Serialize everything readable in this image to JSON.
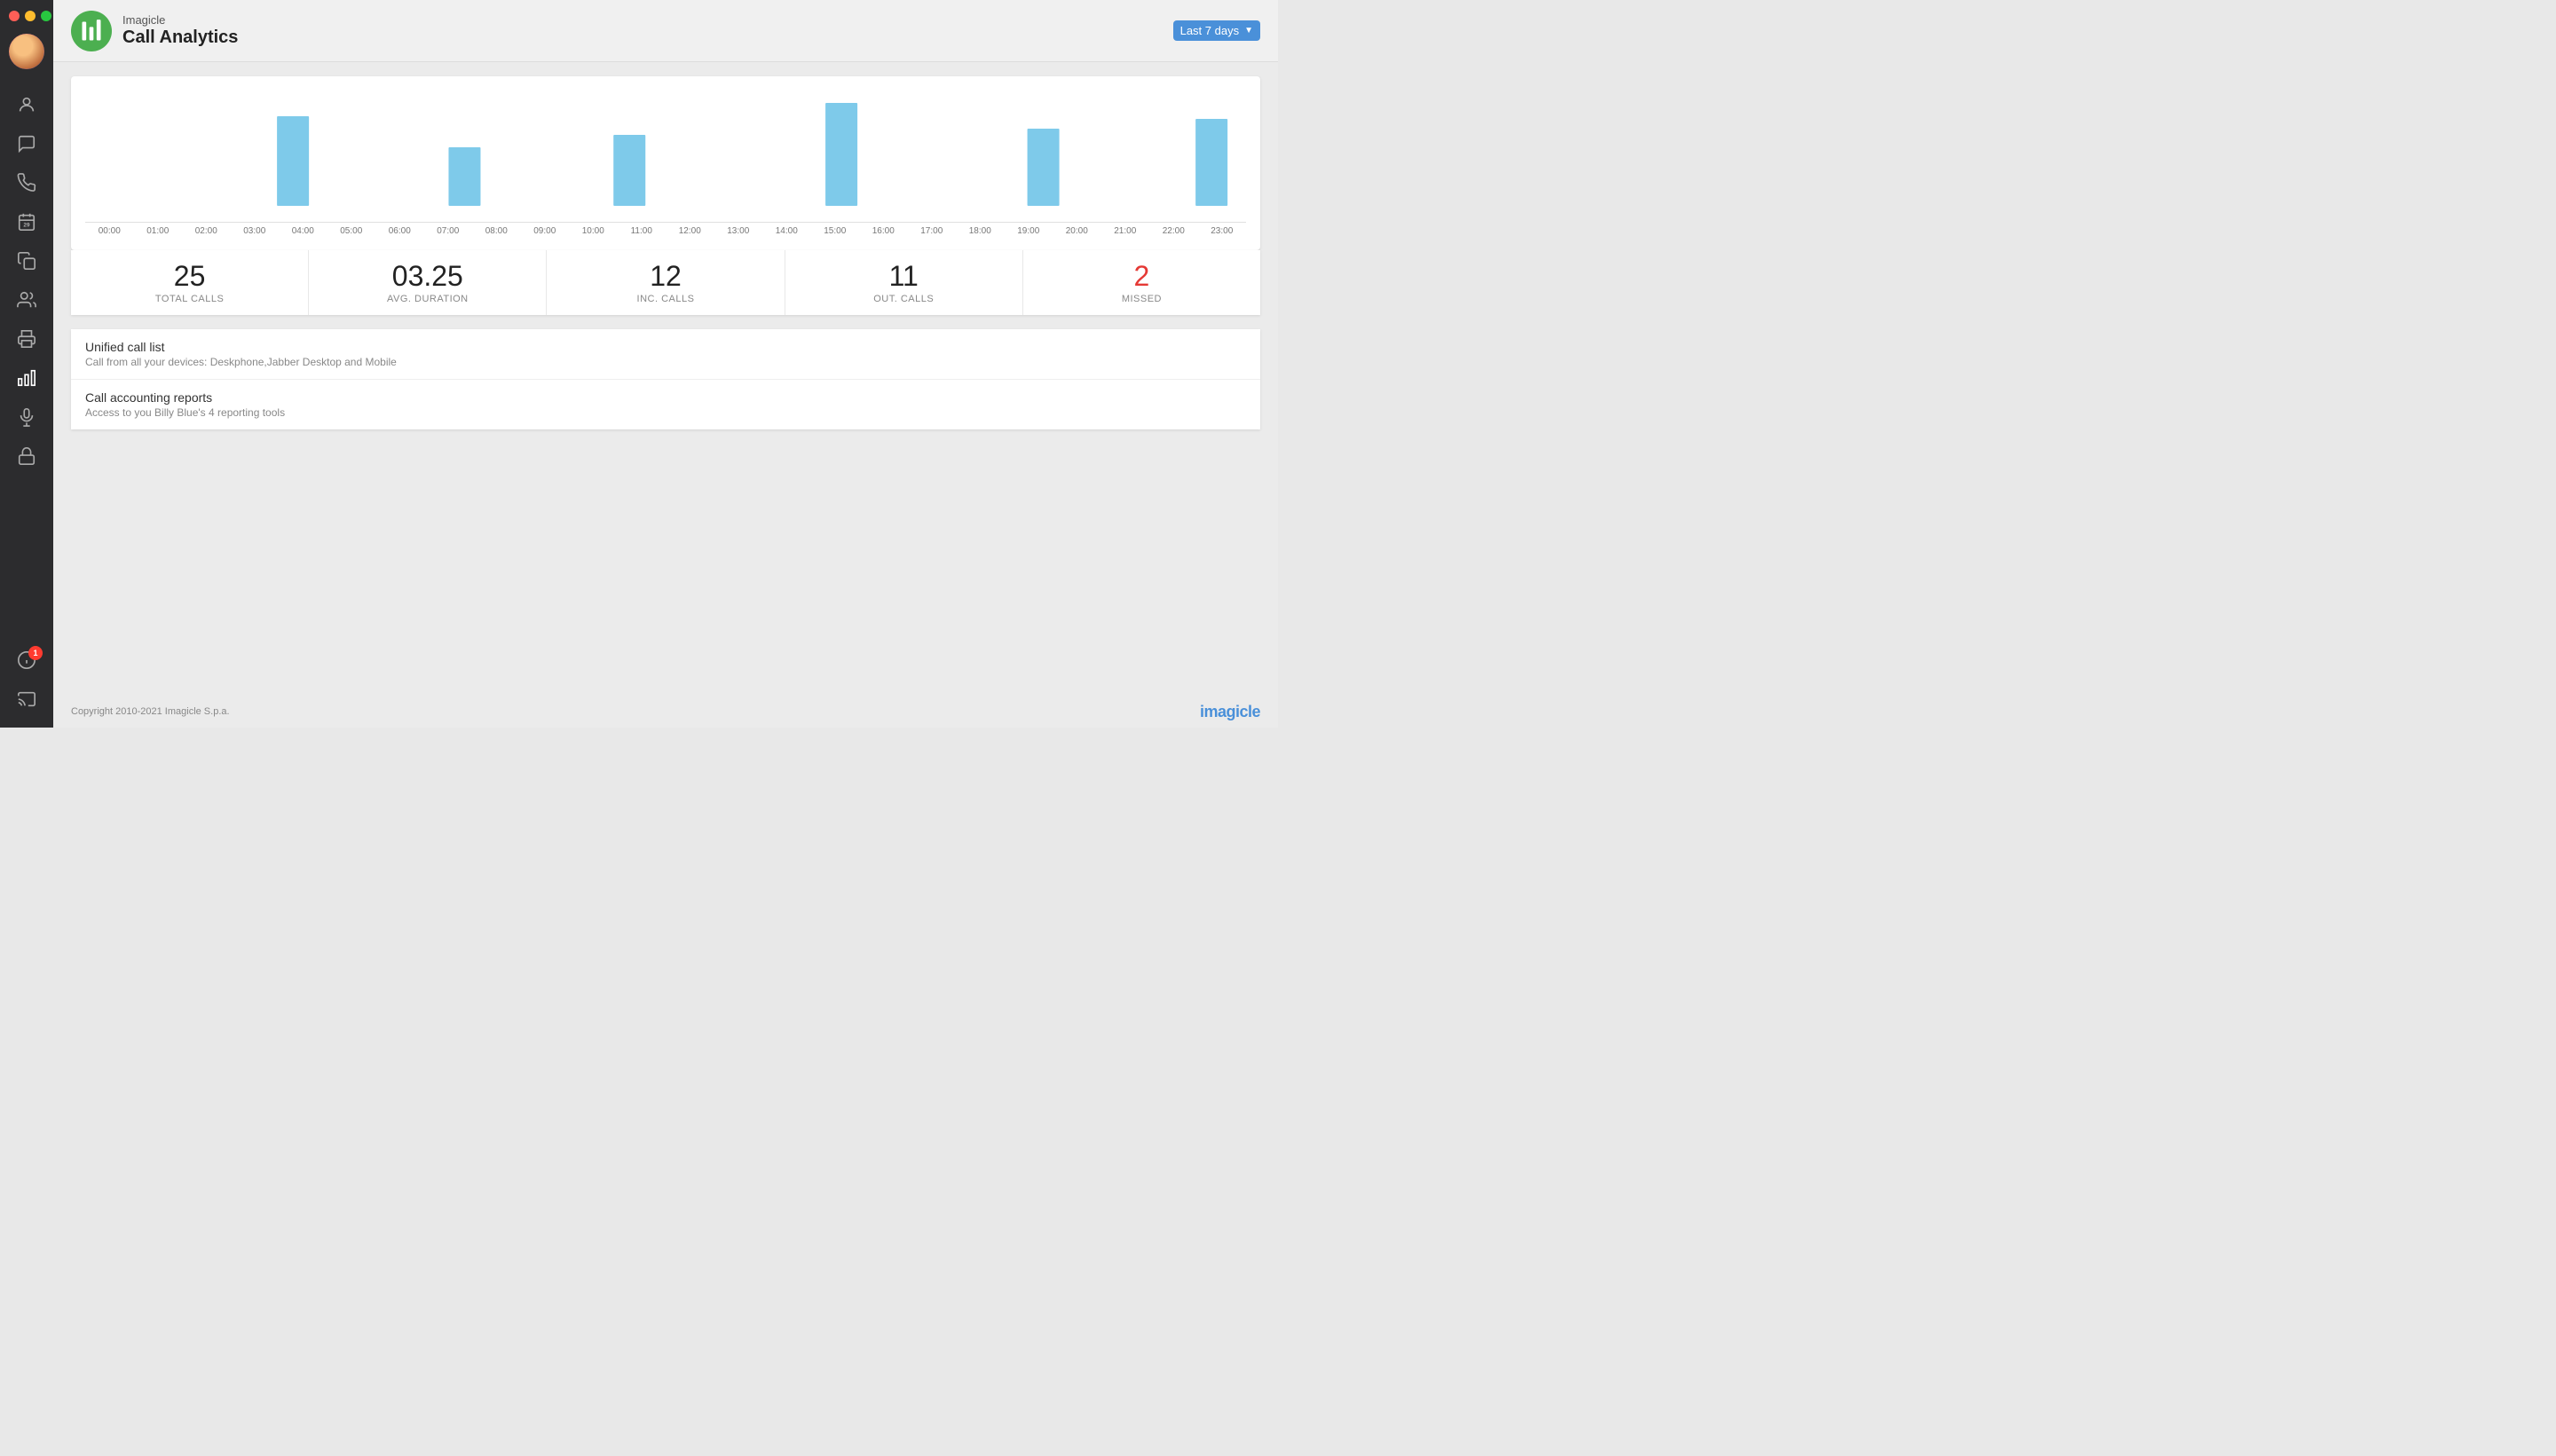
{
  "sidebar": {
    "nav_items": [
      {
        "id": "user",
        "icon": "user-icon",
        "active": false
      },
      {
        "id": "chat",
        "icon": "chat-icon",
        "active": false
      },
      {
        "id": "phone",
        "icon": "phone-icon",
        "active": false
      },
      {
        "id": "calendar",
        "icon": "calendar-icon",
        "active": false
      },
      {
        "id": "copy",
        "icon": "copy-icon",
        "active": false
      },
      {
        "id": "contacts",
        "icon": "contacts-icon",
        "active": false
      },
      {
        "id": "print",
        "icon": "print-icon",
        "active": false
      },
      {
        "id": "analytics",
        "icon": "analytics-icon",
        "active": true
      },
      {
        "id": "mic",
        "icon": "mic-icon",
        "active": false
      },
      {
        "id": "lock",
        "icon": "lock-icon",
        "active": false
      }
    ],
    "bottom_items": [
      {
        "id": "info",
        "icon": "info-icon",
        "badge": "1"
      },
      {
        "id": "cast",
        "icon": "cast-icon"
      }
    ]
  },
  "header": {
    "app_name_top": "Imagicle",
    "app_name_main": "Call Analytics",
    "date_filter": "Last 7 days"
  },
  "chart": {
    "bars": [
      {
        "hour": "00:00",
        "value": 0
      },
      {
        "hour": "01:00",
        "value": 0
      },
      {
        "hour": "02:00",
        "value": 0
      },
      {
        "hour": "03:00",
        "value": 0
      },
      {
        "hour": "04:00",
        "value": 75
      },
      {
        "hour": "05:00",
        "value": 0
      },
      {
        "hour": "06:00",
        "value": 0
      },
      {
        "hour": "07:00",
        "value": 45
      },
      {
        "hour": "08:00",
        "value": 0
      },
      {
        "hour": "09:00",
        "value": 0
      },
      {
        "hour": "10:00",
        "value": 55
      },
      {
        "hour": "11:00",
        "value": 0
      },
      {
        "hour": "12:00",
        "value": 0
      },
      {
        "hour": "13:00",
        "value": 0
      },
      {
        "hour": "14:00",
        "value": 90
      },
      {
        "hour": "15:00",
        "value": 0
      },
      {
        "hour": "16:00",
        "value": 0
      },
      {
        "hour": "17:00",
        "value": 0
      },
      {
        "hour": "18:00",
        "value": 60
      },
      {
        "hour": "19:00",
        "value": 0
      },
      {
        "hour": "20:00",
        "value": 0
      },
      {
        "hour": "21:00",
        "value": 0
      },
      {
        "hour": "22:00",
        "value": 72
      },
      {
        "hour": "23:00",
        "value": 0
      }
    ]
  },
  "stats": [
    {
      "id": "total-calls",
      "value": "25",
      "label": "TOTAL CALLS",
      "red": false
    },
    {
      "id": "avg-duration",
      "value": "03.25",
      "label": "AVG. DURATION",
      "red": false
    },
    {
      "id": "inc-calls",
      "value": "12",
      "label": "INC. CALLS",
      "red": false
    },
    {
      "id": "out-calls",
      "value": "11",
      "label": "OUT. CALLS",
      "red": false
    },
    {
      "id": "missed",
      "value": "2",
      "label": "MISSED",
      "red": true
    }
  ],
  "links": [
    {
      "id": "unified-call-list",
      "title": "Unified call list",
      "description": "Call from all your devices: Deskphone,Jabber Desktop and Mobile"
    },
    {
      "id": "call-accounting-reports",
      "title": "Call accounting reports",
      "description": "Access to you Billy Blue's 4 reporting tools"
    }
  ],
  "footer": {
    "copyright": "Copyright 2010-2021 Imagicle S.p.a.",
    "logo": "imagicle"
  }
}
